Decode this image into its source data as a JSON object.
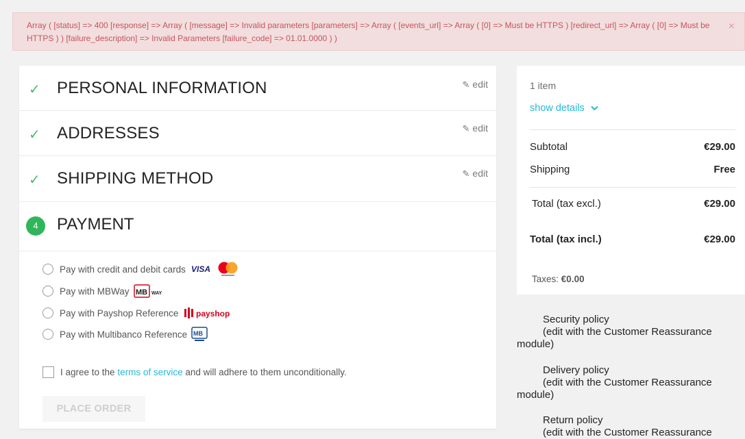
{
  "alert": {
    "message": "Array ( [status] => 400 [response] => Array ( [message] => Invalid parameters [parameters] => Array ( [events_url] => Array ( [0] => Must be HTTPS ) [redirect_url] => Array ( [0] => Must be HTTPS ) ) [failure_description] => Invalid Parameters [failure_code] => 01.01.0000 ) )",
    "close_glyph": "×"
  },
  "steps": [
    {
      "title": "PERSONAL INFORMATION",
      "edit_label": "edit"
    },
    {
      "title": "ADDRESSES",
      "edit_label": "edit"
    },
    {
      "title": "SHIPPING METHOD",
      "edit_label": "edit"
    }
  ],
  "payment": {
    "step_number": "4",
    "title": "PAYMENT",
    "options": [
      {
        "label": "Pay with credit and debit cards",
        "logo": "visa-mastercard"
      },
      {
        "label": "Pay with MBWay",
        "logo": "mbway"
      },
      {
        "label": "Pay with Payshop Reference",
        "logo": "payshop"
      },
      {
        "label": "Pay with Multibanco Reference",
        "logo": "multibanco"
      }
    ],
    "terms_prefix": "I agree to the",
    "terms_link": "terms of service",
    "terms_suffix": "and will adhere to them unconditionally.",
    "place_order_label": "PLACE ORDER"
  },
  "summary": {
    "item_count": "1 item",
    "show_details": "show details",
    "subtotal_label": "Subtotal",
    "subtotal_value": "€29.00",
    "shipping_label": "Shipping",
    "shipping_value": "Free",
    "total_excl_label": "Total (tax excl.)",
    "total_excl_value": "€29.00",
    "total_incl_label": "Total (tax incl.)",
    "total_incl_value": "€29.00",
    "taxes_label": "Taxes:",
    "taxes_value": "€0.00"
  },
  "reassurance": [
    {
      "title": "Security policy",
      "note": "(edit with the Customer Reassurance",
      "note_end": "module)"
    },
    {
      "title": "Delivery policy",
      "note": "(edit with the Customer Reassurance",
      "note_end": "module)"
    },
    {
      "title": "Return policy",
      "note": "(edit with the Customer Reassurance",
      "note_end": ""
    }
  ],
  "colors": {
    "success": "#2fb65a",
    "link": "#24b9d7",
    "error_bg": "#f2dede",
    "error_text": "#c5545f"
  }
}
